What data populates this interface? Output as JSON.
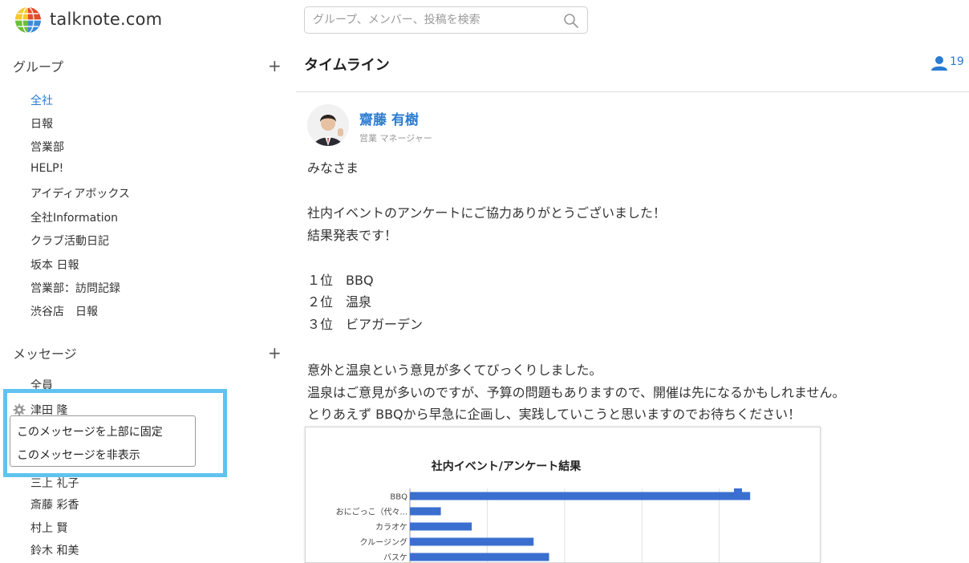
{
  "header": {
    "brand": "talknote.com",
    "search_placeholder": "グループ、メンバー、投稿を検索"
  },
  "sidebar": {
    "groups_title": "グループ",
    "groups": [
      {
        "label": "全社",
        "active": true
      },
      {
        "label": "日報"
      },
      {
        "label": "営業部"
      },
      {
        "label": "HELP!"
      },
      {
        "label": "アイディアボックス"
      },
      {
        "label": "全社Information"
      },
      {
        "label": "クラブ活動日記"
      },
      {
        "label": "坂本 日報"
      },
      {
        "label": "営業部：訪問記録"
      },
      {
        "label": "渋谷店　日報"
      }
    ],
    "messages_title": "メッセージ",
    "messages": [
      {
        "label": "全員"
      },
      {
        "label": "津田 隆"
      },
      {
        "label": "三上 礼子"
      },
      {
        "label": "斎藤 彩香"
      },
      {
        "label": "村上 賢"
      },
      {
        "label": "鈴木 和美"
      }
    ],
    "context_menu": [
      "このメッセージを上部に固定",
      "このメッセージを非表示"
    ]
  },
  "timeline": {
    "title": "タイムライン",
    "member_count": "19",
    "post": {
      "author": "齋藤 有樹",
      "role": "営業 マネージャー",
      "lines": [
        "みなさま",
        "",
        "社内イベントのアンケートにご協力ありがとうございました！",
        "結果発表です！",
        "",
        "１位　BBQ",
        "２位　温泉",
        "３位　ビアガーデン",
        "",
        "意外と温泉という意見が多くてびっくりしました。",
        "温泉はご意見が多いのですが、予算の問題もありますので、開催は先になるかもしれません。",
        "とりあえず BBQから早急に企画し、実践していこうと思いますのでお待ちください！"
      ]
    }
  },
  "colors": {
    "link": "#2a7bd1",
    "highlight": "#5fc3ee",
    "bar": "#3a6fd0"
  },
  "chart_data": {
    "type": "bar",
    "orientation": "horizontal",
    "title": "社内イベント/アンケート結果",
    "categories": [
      "BBQ",
      "おにごっこ（代々...",
      "カラオケ",
      "クルージング",
      "バスケ"
    ],
    "values": [
      22,
      2,
      4,
      8,
      9
    ],
    "xlim": [
      0,
      25
    ],
    "legend": "right"
  }
}
